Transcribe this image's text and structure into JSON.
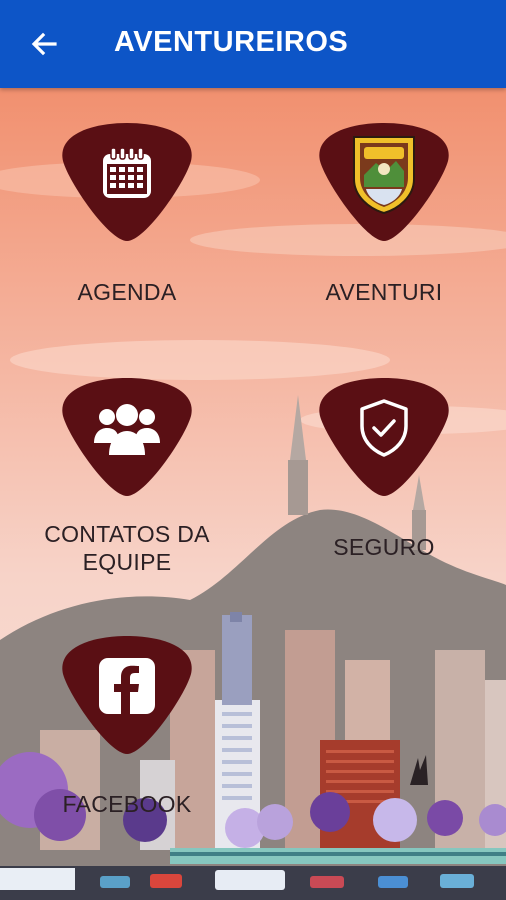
{
  "appbar": {
    "title": "AVENTUREIROS",
    "back_icon": "arrow-left-icon",
    "color": "#0d55c7"
  },
  "menu": {
    "tile_color": "#5a0f14",
    "items": [
      {
        "label": "AGENDA",
        "icon": "calendar-icon"
      },
      {
        "label": "AVENTURI",
        "icon": "badge-emblem-icon"
      },
      {
        "label": "CONTATOS DA EQUIPE",
        "icon": "group-icon"
      },
      {
        "label": "SEGURO",
        "icon": "shield-check-icon"
      },
      {
        "label": "FACEBOOK",
        "icon": "facebook-icon"
      }
    ]
  }
}
